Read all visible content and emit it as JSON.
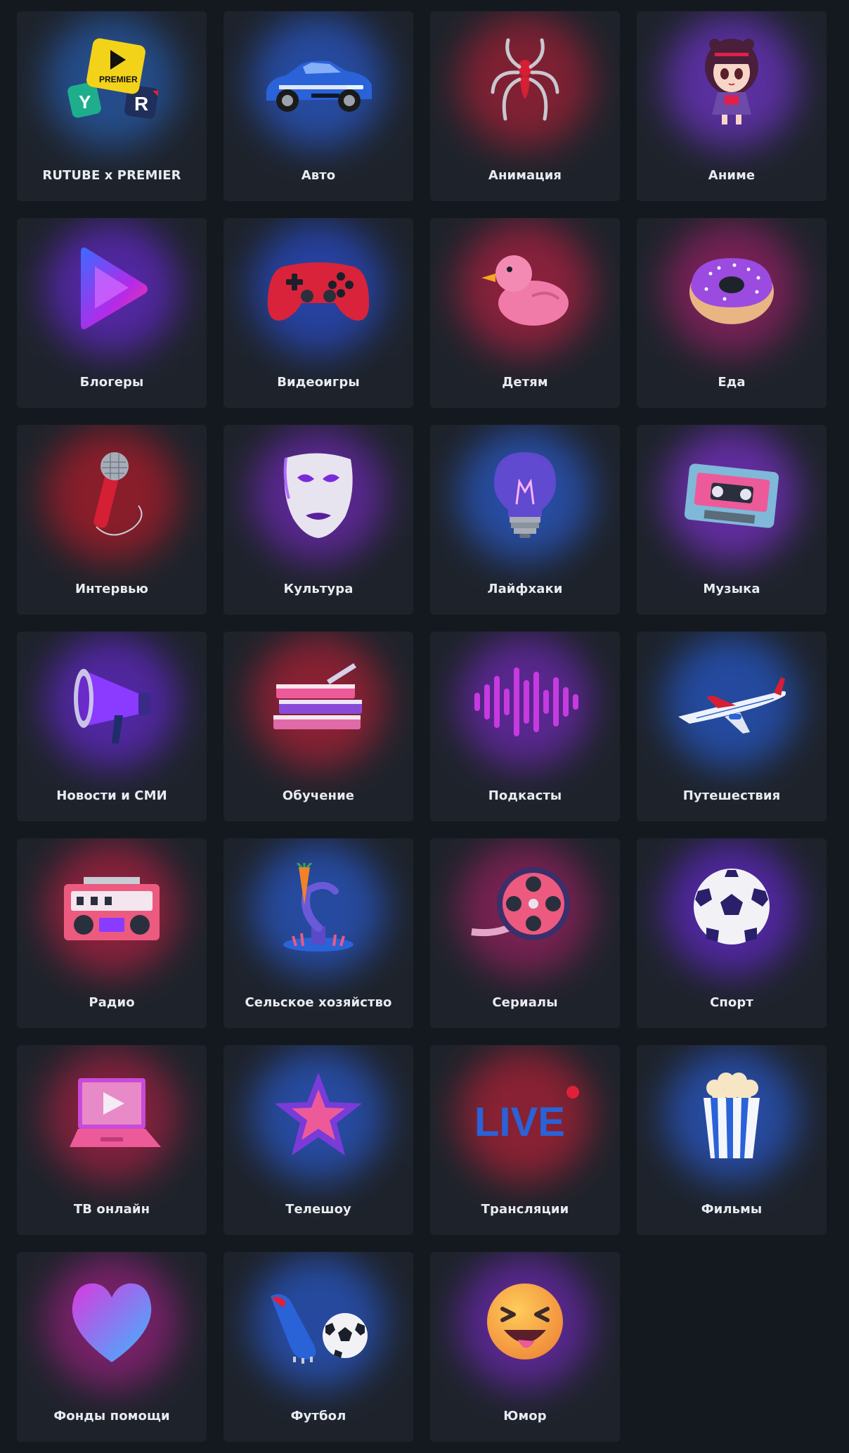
{
  "categories": [
    {
      "label": "RUTUBE x PREMIER",
      "icon": "rutube-premier-logo-icon",
      "glow": "#2b6fd8"
    },
    {
      "label": "Авто",
      "icon": "sports-car-icon",
      "glow": "#2e6bff"
    },
    {
      "label": "Анимация",
      "icon": "spider-emblem-icon",
      "glow": "#d0203a"
    },
    {
      "label": "Аниме",
      "icon": "anime-girl-icon",
      "glow": "#8b3bff"
    },
    {
      "label": "Блогеры",
      "icon": "play-button-icon",
      "glow": "#7b2bff"
    },
    {
      "label": "Видеоигры",
      "icon": "gamepad-icon",
      "glow": "#2d5bff"
    },
    {
      "label": "Детям",
      "icon": "rubber-duck-icon",
      "glow": "#e0204a"
    },
    {
      "label": "Еда",
      "icon": "donut-icon",
      "glow": "#c0207a"
    },
    {
      "label": "Интервью",
      "icon": "microphone-icon",
      "glow": "#e01a2a"
    },
    {
      "label": "Культура",
      "icon": "theater-mask-icon",
      "glow": "#8a2be2"
    },
    {
      "label": "Лайфхаки",
      "icon": "lightbulb-icon",
      "glow": "#2f6dff"
    },
    {
      "label": "Музыка",
      "icon": "cassette-tape-icon",
      "glow": "#9a35ff"
    },
    {
      "label": "Новости и СМИ",
      "icon": "megaphone-icon",
      "glow": "#7a2bff"
    },
    {
      "label": "Обучение",
      "icon": "books-icon",
      "glow": "#e0203a"
    },
    {
      "label": "Подкасты",
      "icon": "sound-wave-icon",
      "glow": "#8a2be2"
    },
    {
      "label": "Путешествия",
      "icon": "airplane-icon",
      "glow": "#2a6bff"
    },
    {
      "label": "Радио",
      "icon": "boombox-icon",
      "glow": "#e0204a"
    },
    {
      "label": "Сельское хозяйство",
      "icon": "robot-arm-carrot-icon",
      "glow": "#2e6bff"
    },
    {
      "label": "Сериалы",
      "icon": "film-reel-icon",
      "glow": "#c02070"
    },
    {
      "label": "Спорт",
      "icon": "soccer-ball-icon",
      "glow": "#7a2bff"
    },
    {
      "label": "ТВ онлайн",
      "icon": "laptop-play-icon",
      "glow": "#d0204a"
    },
    {
      "label": "Телешоу",
      "icon": "star-icon",
      "glow": "#2e6bff"
    },
    {
      "label": "Трансляции",
      "icon": "live-sign-icon",
      "glow": "#e0203a"
    },
    {
      "label": "Фильмы",
      "icon": "popcorn-icon",
      "glow": "#2e6bff"
    },
    {
      "label": "Фонды помощи",
      "icon": "heart-icon",
      "glow": "#c0209a"
    },
    {
      "label": "Футбол",
      "icon": "football-boot-and-ball-icon",
      "glow": "#2e6bff"
    },
    {
      "label": "Юмор",
      "icon": "laughing-face-icon",
      "glow": "#8a2be2"
    }
  ]
}
